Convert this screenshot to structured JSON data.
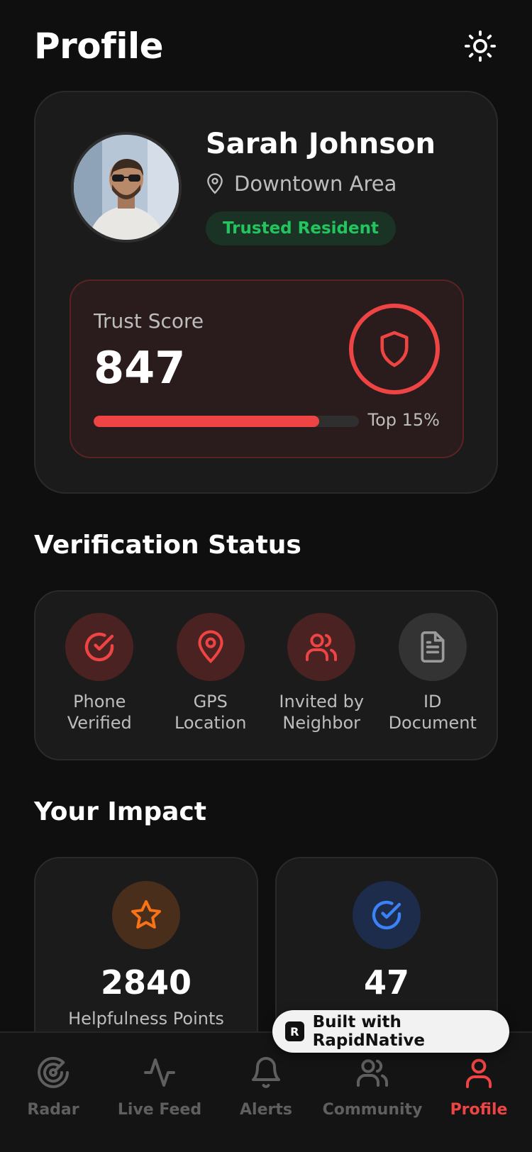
{
  "header": {
    "title": "Profile",
    "theme_icon": "sun-icon"
  },
  "profile": {
    "name": "Sarah Johnson",
    "location": "Downtown Area",
    "badge": "Trusted Resident",
    "trust": {
      "label": "Trust Score",
      "score": "847",
      "progress_fraction": 0.85,
      "rank": "Top 15%"
    }
  },
  "verification": {
    "title": "Verification Status",
    "items": [
      {
        "label": "Phone\nVerified",
        "icon": "check-circle-icon",
        "verified": true
      },
      {
        "label": "GPS\nLocation",
        "icon": "map-pin-icon",
        "verified": true
      },
      {
        "label": "Invited by\nNeighbor",
        "icon": "users-icon",
        "verified": true
      },
      {
        "label": "ID\nDocument",
        "icon": "document-icon",
        "verified": false
      }
    ]
  },
  "impact": {
    "title": "Your Impact",
    "cards": [
      {
        "value": "2840",
        "label": "Helpfulness Points",
        "icon": "star-icon",
        "color": "#f97316"
      },
      {
        "value": "47",
        "label": "",
        "icon": "check-circle-icon",
        "color": "#3b82f6"
      }
    ]
  },
  "nav": {
    "items": [
      {
        "label": "Radar",
        "icon": "radar-icon",
        "active": false
      },
      {
        "label": "Live Feed",
        "icon": "activity-icon",
        "active": false
      },
      {
        "label": "Alerts",
        "icon": "bell-icon",
        "active": false
      },
      {
        "label": "Community",
        "icon": "users-icon",
        "active": false
      },
      {
        "label": "Profile",
        "icon": "user-icon",
        "active": true
      }
    ]
  },
  "rapidnative": {
    "label": "Built with RapidNative"
  },
  "colors": {
    "accent": "#ef4444",
    "success": "#22c55e",
    "orange": "#f97316",
    "blue": "#3b82f6"
  }
}
